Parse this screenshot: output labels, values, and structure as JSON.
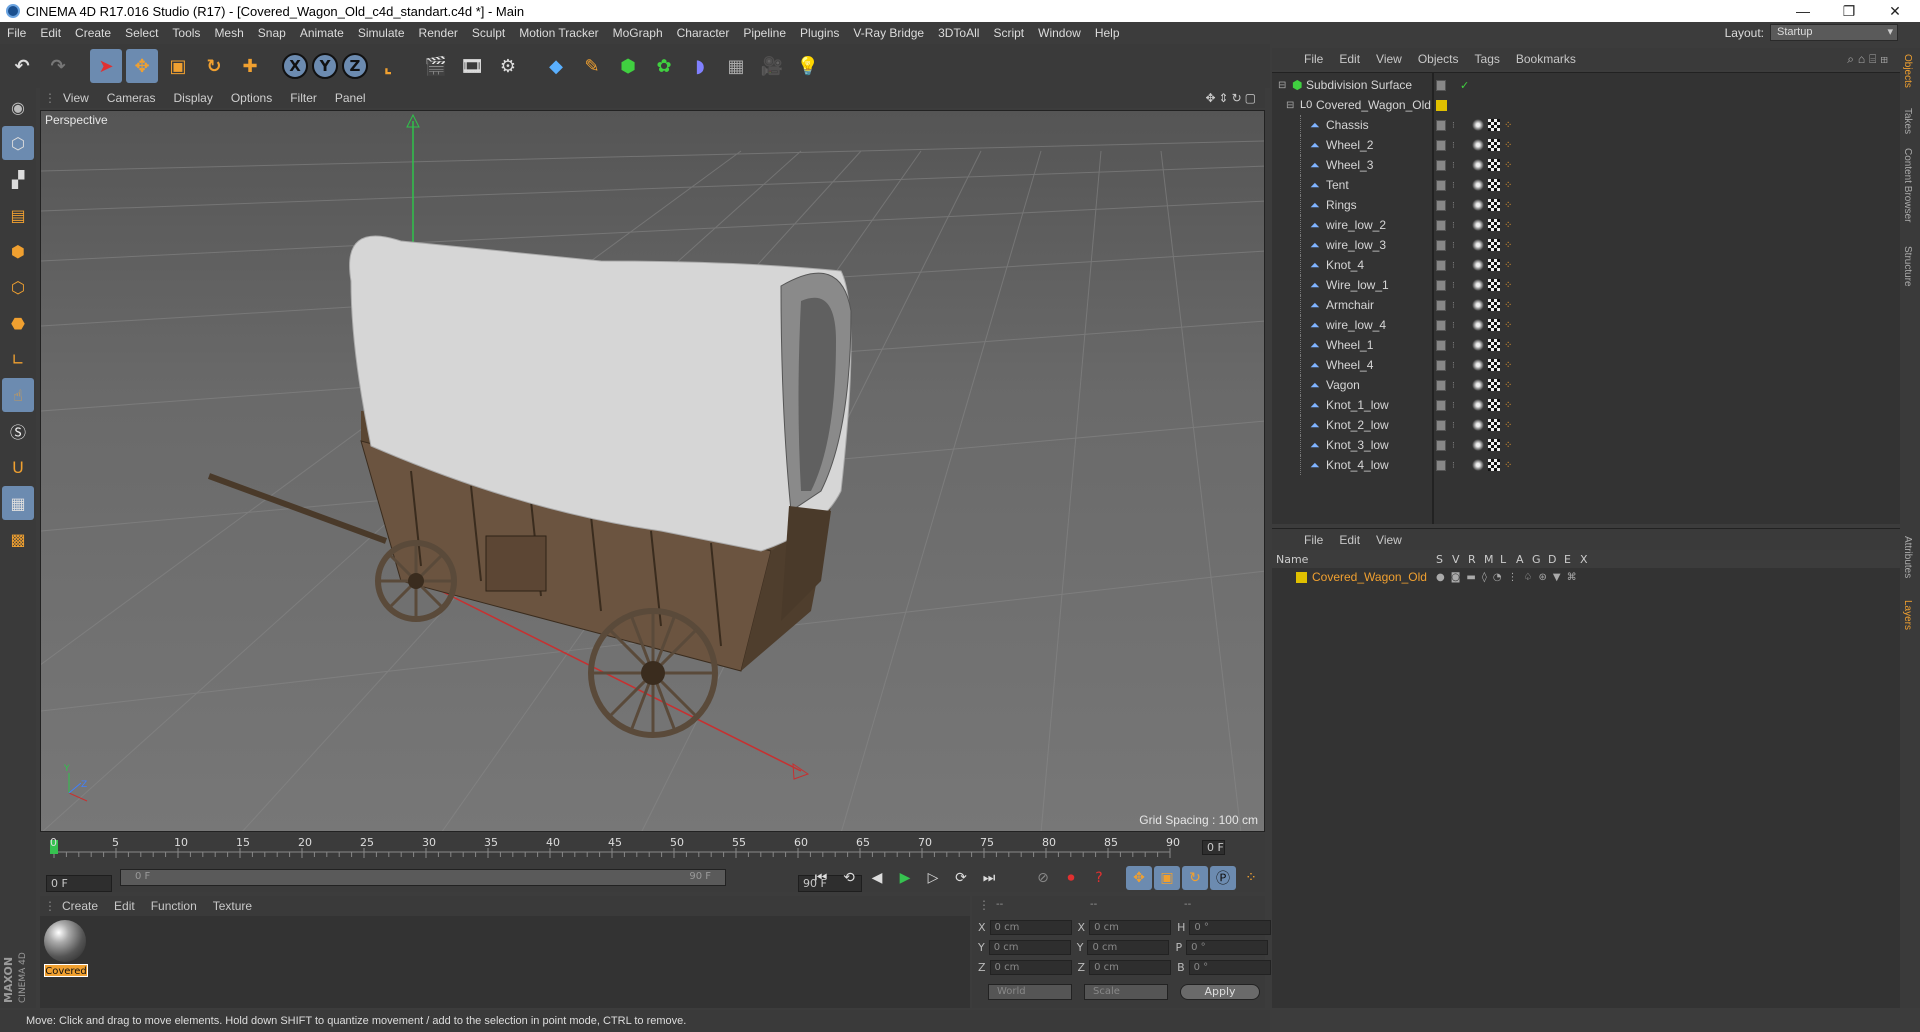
{
  "window": {
    "title": "CINEMA 4D R17.016 Studio (R17) - [Covered_Wagon_Old_c4d_standart.c4d *] - Main",
    "minimize": "—",
    "maximize": "❐",
    "close": "✕"
  },
  "menubar": {
    "items": [
      "File",
      "Edit",
      "Create",
      "Select",
      "Tools",
      "Mesh",
      "Snap",
      "Animate",
      "Simulate",
      "Render",
      "Sculpt",
      "Motion Tracker",
      "MoGraph",
      "Character",
      "Pipeline",
      "Plugins",
      "V-Ray Bridge",
      "3DToAll",
      "Script",
      "Window",
      "Help"
    ],
    "layout_label": "Layout:",
    "layout_value": "Startup"
  },
  "viewport": {
    "menu": [
      "View",
      "Cameras",
      "Display",
      "Options",
      "Filter",
      "Panel"
    ],
    "label": "Perspective",
    "grid_spacing": "Grid Spacing : 100 cm"
  },
  "timeline": {
    "ticks": [
      "0",
      "5",
      "10",
      "15",
      "20",
      "25",
      "30",
      "35",
      "40",
      "45",
      "50",
      "55",
      "60",
      "65",
      "70",
      "75",
      "80",
      "85",
      "90"
    ],
    "current_frame": "0 F",
    "start_field": "0 F",
    "range_start": "0 F",
    "range_end": "90 F",
    "end_field": "90 F"
  },
  "material_manager": {
    "menu": [
      "Create",
      "Edit",
      "Function",
      "Texture"
    ],
    "material_label": "Covered"
  },
  "coordinates": {
    "header": [
      "--",
      "--",
      "--"
    ],
    "rows": [
      {
        "a": "X",
        "av": "0 cm",
        "b": "X",
        "bv": "0 cm",
        "c": "H",
        "cv": "0 °"
      },
      {
        "a": "Y",
        "av": "0 cm",
        "b": "Y",
        "bv": "0 cm",
        "c": "P",
        "cv": "0 °"
      },
      {
        "a": "Z",
        "av": "0 cm",
        "b": "Z",
        "bv": "0 cm",
        "c": "B",
        "cv": "0 °"
      }
    ],
    "mode": "World",
    "scale": "Scale",
    "apply": "Apply"
  },
  "status": "Move: Click and drag to move elements. Hold down SHIFT to quantize movement / add to the selection in point mode, CTRL to remove.",
  "object_manager": {
    "menu": [
      "File",
      "Edit",
      "View",
      "Objects",
      "Tags",
      "Bookmarks"
    ],
    "root": "Subdivision Surface",
    "group": "Covered_Wagon_Old",
    "children": [
      "Chassis",
      "Wheel_2",
      "Wheel_3",
      "Tent",
      "Rings",
      "wire_low_2",
      "wire_low_3",
      "Knot_4",
      "Wire_low_1",
      "Armchair",
      "wire_low_4",
      "Wheel_1",
      "Wheel_4",
      "Vagon",
      "Knot_1_low",
      "Knot_2_low",
      "Knot_3_low",
      "Knot_4_low"
    ]
  },
  "layer_manager": {
    "menu": [
      "File",
      "Edit",
      "View"
    ],
    "columns": [
      "Name",
      "S",
      "V",
      "R",
      "M",
      "L",
      "A",
      "G",
      "D",
      "E",
      "X"
    ],
    "layer": "Covered_Wagon_Old"
  },
  "right_tabs": [
    "Objects",
    "Takes",
    "Content Browser",
    "Structure",
    "Attributes",
    "Layers"
  ],
  "colors": {
    "accent": "#6c8bb0",
    "layer_yellow": "#e0c000",
    "orange": "#f0a030"
  },
  "brand": {
    "maxon": "MAXON",
    "cinema": "CINEMA 4D"
  }
}
